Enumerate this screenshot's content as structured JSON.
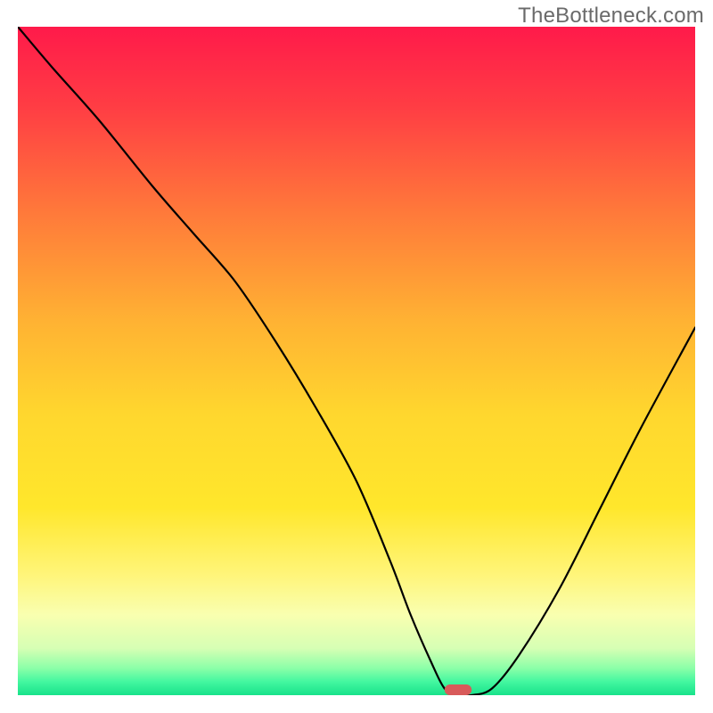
{
  "watermark": "TheBottleneck.com",
  "chart_data": {
    "type": "line",
    "title": "",
    "xlabel": "",
    "ylabel": "",
    "xlim": [
      0,
      100
    ],
    "ylim": [
      0,
      100
    ],
    "grid": false,
    "legend": false,
    "gradient_stops": [
      {
        "offset": 0,
        "color": "#ff1a4a"
      },
      {
        "offset": 12,
        "color": "#ff3d44"
      },
      {
        "offset": 28,
        "color": "#ff7a3a"
      },
      {
        "offset": 44,
        "color": "#ffb233"
      },
      {
        "offset": 58,
        "color": "#ffd72e"
      },
      {
        "offset": 72,
        "color": "#ffe72c"
      },
      {
        "offset": 82,
        "color": "#fff57a"
      },
      {
        "offset": 88,
        "color": "#f9ffb0"
      },
      {
        "offset": 93,
        "color": "#d6ffb4"
      },
      {
        "offset": 96,
        "color": "#8affa8"
      },
      {
        "offset": 98,
        "color": "#43f7a0"
      },
      {
        "offset": 100,
        "color": "#18e28a"
      }
    ],
    "series": [
      {
        "name": "bottleneck-curve",
        "x": [
          0,
          5,
          12,
          20,
          26,
          32,
          38,
          44,
          50,
          55,
          58,
          61,
          63,
          65,
          67,
          70,
          74,
          80,
          86,
          92,
          100
        ],
        "y": [
          100,
          94,
          86,
          76,
          69,
          62,
          53,
          43,
          32,
          20,
          12,
          5,
          1,
          0,
          0,
          1,
          6,
          16,
          28,
          40,
          55
        ]
      }
    ],
    "marker": {
      "name": "optimal-range-marker",
      "x_center": 65,
      "y": 0,
      "width": 4,
      "color": "#d85a5a"
    }
  }
}
